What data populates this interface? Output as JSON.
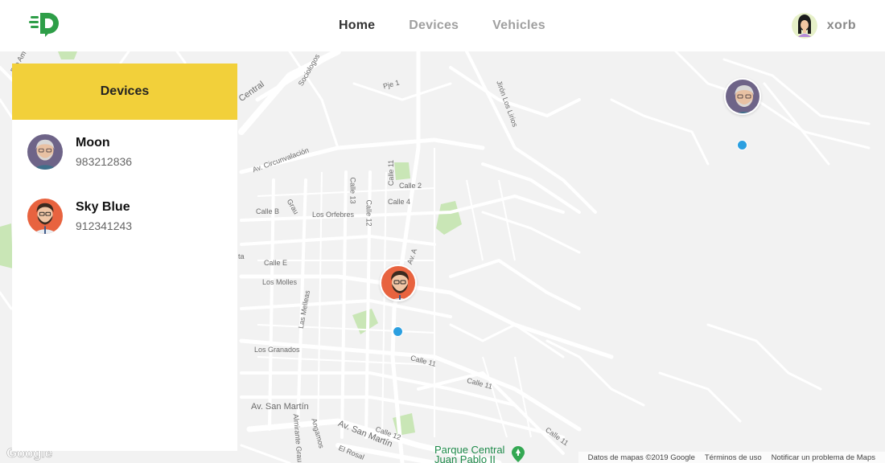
{
  "header": {
    "nav": [
      {
        "label": "Home",
        "active": true
      },
      {
        "label": "Devices",
        "active": false
      },
      {
        "label": "Vehicles",
        "active": false
      }
    ],
    "user": {
      "name": "xorb",
      "avatar_icon": "woman-avatar-icon"
    }
  },
  "brand": {
    "logo_icon": "d-speed-logo-icon",
    "color": "#2e9e48"
  },
  "panel": {
    "title": "Devices",
    "header_color": "#f2d03a",
    "devices": [
      {
        "name": "Moon",
        "number": "983212836",
        "avatar_icon": "old-man-avatar-icon"
      },
      {
        "name": "Sky Blue",
        "number": "912341243",
        "avatar_icon": "bearded-man-avatar-icon"
      }
    ]
  },
  "map": {
    "marker_dot_color": "#2b9fe0",
    "street_labels": [
      "Río Am",
      "Sociologos",
      "Pje 1",
      "Jirón Los Lirios",
      "Central",
      "Av. Circunvalación",
      "Calle 11",
      "Calle 2",
      "Calle 13",
      "Calle 4",
      "Calle B",
      "Grau",
      "Los Orfebres",
      "Calle 12",
      "Av. A",
      "Calle E",
      "Los Molles",
      "Las Melleas",
      "Los Granados",
      "Calle 11",
      "Calle 11",
      "Av. San Martín",
      "Av. San Martín",
      "Almirante Grau",
      "Angamos",
      "El Rosal",
      "Calle 12",
      "Calle 11",
      "ta"
    ],
    "park_label": "Parque Central\nJuan Pablo II",
    "footer": {
      "copyright": "Datos de mapas ©2019 Google",
      "terms": "Términos de uso",
      "report": "Notificar un problema de Maps"
    },
    "google_logo": "Google"
  }
}
